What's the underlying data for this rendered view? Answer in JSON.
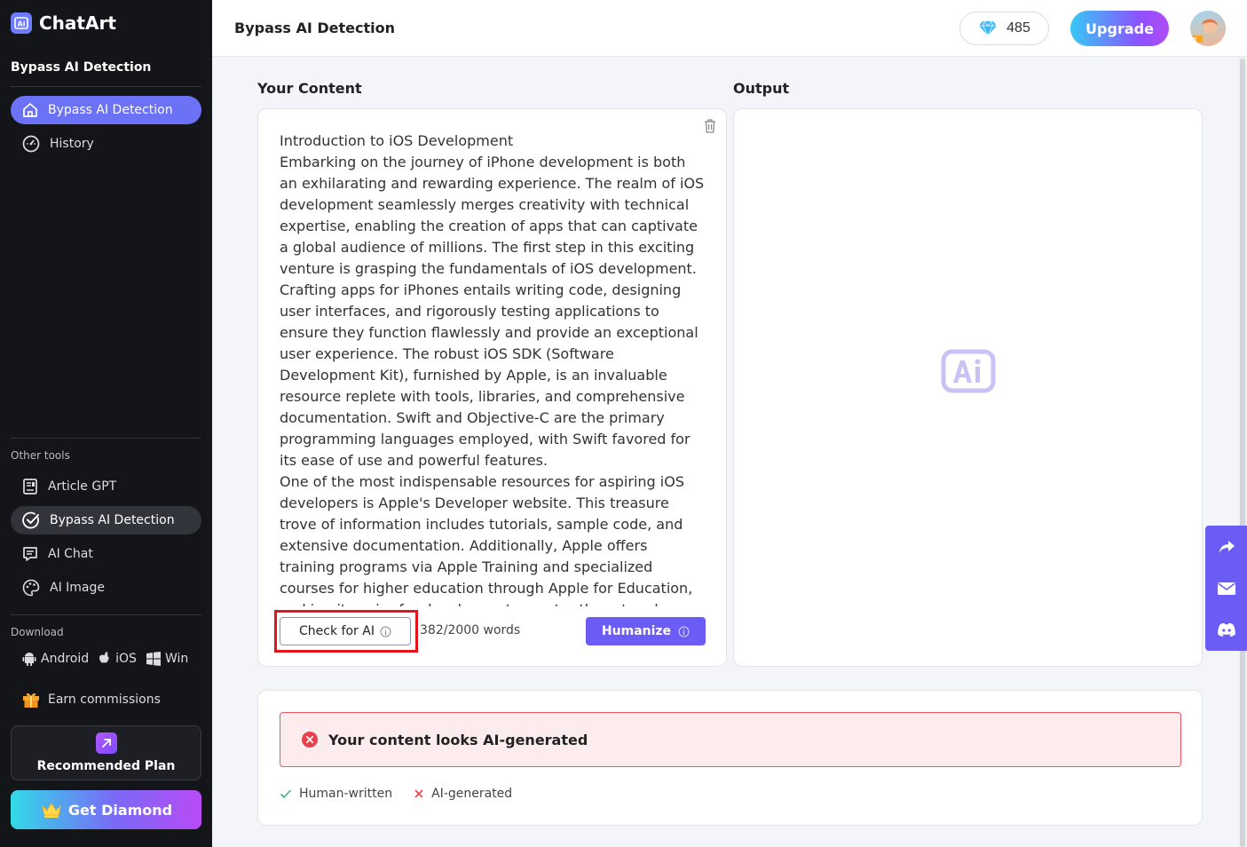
{
  "app": {
    "name": "ChatArt"
  },
  "sidebar": {
    "heading": "Bypass AI Detection",
    "main_items": [
      {
        "label": "Bypass AI Detection",
        "icon": "home-icon",
        "active": true
      },
      {
        "label": "History",
        "icon": "history-icon",
        "active": false
      }
    ],
    "other_tools_label": "Other tools",
    "tools": [
      {
        "label": "Article GPT",
        "icon": "article-icon",
        "active": false
      },
      {
        "label": "Bypass AI Detection",
        "icon": "check-circle-icon",
        "active": true
      },
      {
        "label": "AI Chat",
        "icon": "chat-icon",
        "active": false
      },
      {
        "label": "AI Image",
        "icon": "palette-icon",
        "active": false
      }
    ],
    "download_label": "Download",
    "downloads": [
      {
        "label": "Android",
        "icon": "android-icon"
      },
      {
        "label": "iOS",
        "icon": "apple-icon"
      },
      {
        "label": "Win",
        "icon": "windows-icon"
      }
    ],
    "earn_label": "Earn commissions",
    "recommended_plan_label": "Recommended Plan",
    "get_diamond_label": "Get Diamond"
  },
  "header": {
    "title": "Bypass AI Detection",
    "diamonds": "485",
    "upgrade_label": "Upgrade"
  },
  "main": {
    "content_label": "Your Content",
    "output_label": "Output",
    "content_text": "Introduction to iOS Development\nEmbarking on the journey of iPhone development is both an exhilarating and rewarding experience. The realm of iOS development seamlessly merges creativity with technical expertise, enabling the creation of apps that can captivate a global audience of millions. The first step in this exciting venture is grasping the fundamentals of iOS development. Crafting apps for iPhones entails writing code, designing user interfaces, and rigorously testing applications to ensure they function flawlessly and provide an exceptional user experience. The robust iOS SDK (Software Development Kit), furnished by Apple, is an invaluable resource replete with tools, libraries, and comprehensive documentation. Swift and Objective-C are the primary programming languages employed, with Swift favored for its ease of use and powerful features.\nOne of the most indispensable resources for aspiring iOS developers is Apple's Developer website. This treasure trove of information includes tutorials, sample code, and extensive documentation. Additionally, Apple offers training programs via Apple Training and specialized courses for higher education through Apple for Education, making it easier for developers to master the art and",
    "check_ai_label": "Check for AI",
    "word_count": "382/2000 words",
    "humanize_label": "Humanize"
  },
  "result": {
    "message": "Your content looks AI-generated",
    "legend": [
      {
        "label": "Human-written",
        "icon": "check-icon"
      },
      {
        "label": "AI-generated",
        "icon": "cross-icon"
      }
    ]
  },
  "colors": {
    "accent": "#6b5cf5",
    "sidebar_bg": "#141519",
    "error": "#e8414c"
  }
}
